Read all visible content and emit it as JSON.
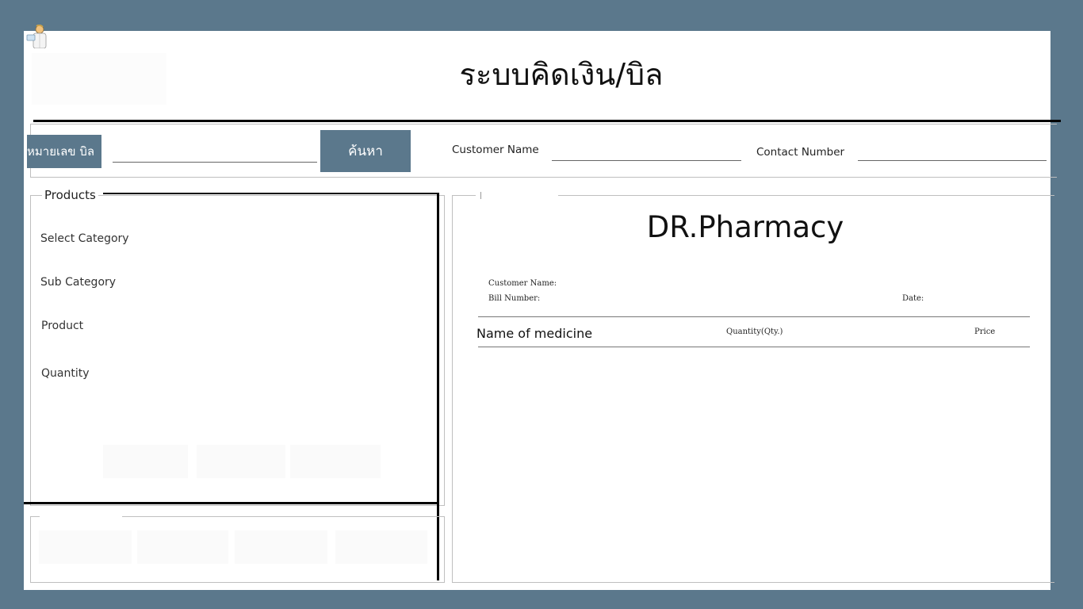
{
  "header": {
    "title": "ระบบคิดเงิน/บิล"
  },
  "search": {
    "bill_label": "หมายเลข บิล",
    "bill_value": "",
    "search_button": "ค้นหา",
    "customer_name_label": "Customer Name",
    "customer_name_value": "",
    "contact_number_label": "Contact Number",
    "contact_number_value": ""
  },
  "products": {
    "legend": "Products",
    "select_category_label": "Select Category",
    "sub_category_label": "Sub Category",
    "product_label": "Product",
    "quantity_label": "Quantity",
    "action_buttons": [
      "",
      "",
      ""
    ]
  },
  "bottom_buttons": [
    "",
    "",
    "",
    ""
  ],
  "bill": {
    "pharmacy_name": "DR.Pharmacy",
    "customer_name_label": "Customer Name:",
    "bill_number_label": "Bill Number:",
    "date_label": "Date:",
    "columns": {
      "medicine": "Name of medicine",
      "quantity": "Quantity(Qty.)",
      "price": "Price"
    }
  },
  "colors": {
    "background": "#5b788c",
    "accent": "#5b788c",
    "panel": "#ffffff"
  }
}
